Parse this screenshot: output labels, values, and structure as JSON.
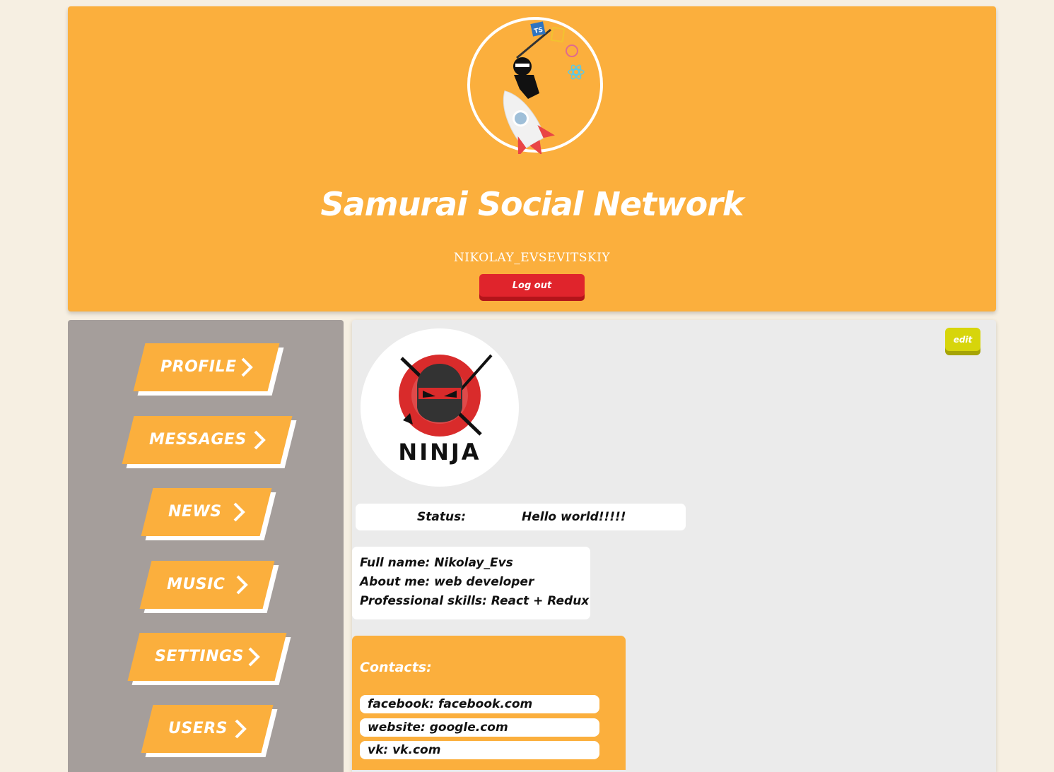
{
  "header": {
    "title": "Samurai Social Network",
    "username": "NIKOLAY_EVSEVITSKIY",
    "logout_label": "Log out",
    "logo_badge": "TS"
  },
  "sidebar": {
    "items": [
      {
        "label": "PROFILE"
      },
      {
        "label": "MESSAGES"
      },
      {
        "label": "NEWS"
      },
      {
        "label": "MUSIC"
      },
      {
        "label": "SETTINGS"
      },
      {
        "label": "USERS"
      }
    ]
  },
  "profile": {
    "edit_label": "edit",
    "avatar_text": "NINJA",
    "status_label": "Status:",
    "status_value": "Hello world!!!!!",
    "full_name": "Full name: Nikolay_Evs",
    "about_me": "About me: web developer",
    "skills": "Professional skills: React + Redux",
    "contacts_title": "Contacts:",
    "contacts": [
      "facebook: facebook.com",
      "website: google.com",
      "vk: vk.com"
    ]
  },
  "colors": {
    "accent": "#fbaf3d",
    "background": "#f6efe2",
    "sidebar": "#a59e9b",
    "content": "#ebebeb",
    "logout": "#e0242c",
    "edit": "#d7d50b"
  }
}
